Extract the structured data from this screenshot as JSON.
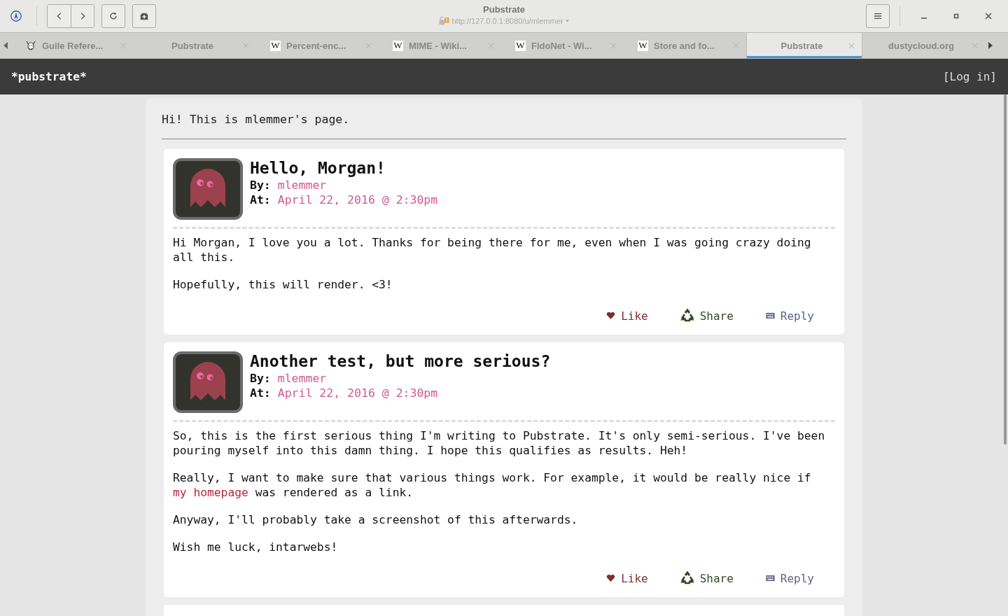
{
  "window": {
    "title": "Pubstrate",
    "url": "http://127.0.0.1:8080/u/mlemmer"
  },
  "tabs": [
    {
      "label": "Guile Refere...",
      "selected": false,
      "kind": "gnu"
    },
    {
      "label": "Pubstrate",
      "selected": false,
      "kind": "plain"
    },
    {
      "label": "Percent-enc...",
      "selected": false,
      "kind": "letter",
      "favicon_letter": "W"
    },
    {
      "label": "MIME - Wiki...",
      "selected": false,
      "kind": "letter",
      "favicon_letter": "W"
    },
    {
      "label": "FidoNet - Wi...",
      "selected": false,
      "kind": "letter",
      "favicon_letter": "W"
    },
    {
      "label": "Store and fo...",
      "selected": false,
      "kind": "letter",
      "favicon_letter": "W"
    },
    {
      "label": "Pubstrate",
      "selected": true,
      "kind": "plain"
    },
    {
      "label": "dustycloud.org",
      "selected": false,
      "kind": "plain"
    }
  ],
  "site": {
    "logo": "*pubstrate*",
    "login": "[Log in]"
  },
  "intro": "Hi! This is mlemmer's page.",
  "posts": [
    {
      "title": "Hello, Morgan!",
      "by_label": "By:",
      "author": "mlemmer",
      "at_label": "At:",
      "date": "April 22, 2016 @ 2:30pm",
      "paragraphs": [
        [
          {
            "kind": "text",
            "text": "Hi Morgan, I love you a lot. Thanks for being there for me, even when I was going crazy doing all this."
          }
        ],
        [
          {
            "kind": "text",
            "text": "Hopefully, this will render. <3!"
          }
        ]
      ],
      "actions": [
        {
          "kind": "like",
          "label": "Like"
        },
        {
          "kind": "share",
          "label": "Share"
        },
        {
          "kind": "reply",
          "label": "Reply"
        }
      ]
    },
    {
      "title": "Another test, but more serious?",
      "by_label": "By:",
      "author": "mlemmer",
      "at_label": "At:",
      "date": "April 22, 2016 @ 2:30pm",
      "paragraphs": [
        [
          {
            "kind": "text",
            "text": "So, this is the first serious thing I'm writing to Pubstrate. It's only semi-serious. I've been pouring myself into this damn thing. I hope this qualifies as results. Heh!"
          }
        ],
        [
          {
            "kind": "text",
            "text": "Really, I want to make sure that various things work. For example, it would be really nice if "
          },
          {
            "kind": "link",
            "text": "my homepage"
          },
          {
            "kind": "text",
            "text": " was rendered as a link."
          }
        ],
        [
          {
            "kind": "text",
            "text": "Anyway, I'll probably take a screenshot of this afterwards."
          }
        ],
        [
          {
            "kind": "text",
            "text": "Wish me luck, intarwebs!"
          }
        ]
      ],
      "actions": [
        {
          "kind": "like",
          "label": "Like"
        },
        {
          "kind": "share",
          "label": "Share"
        },
        {
          "kind": "reply",
          "label": "Reply"
        }
      ]
    }
  ]
}
